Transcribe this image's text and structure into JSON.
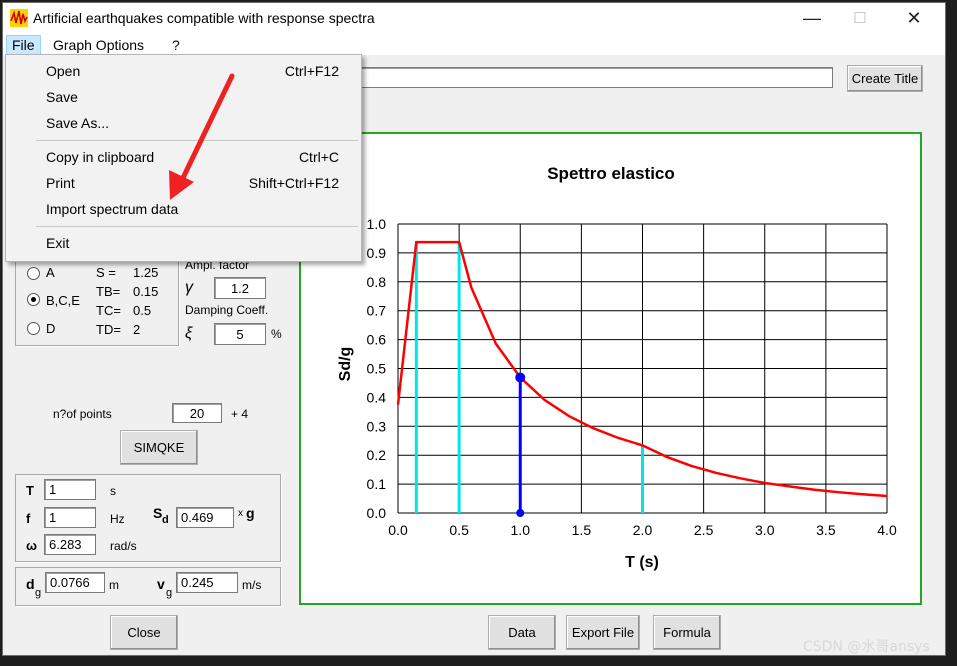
{
  "window": {
    "title": "Artificial earthquakes compatible with response spectra",
    "minimize": "—",
    "maximize": "☐",
    "close": "✕"
  },
  "menubar": {
    "file": "File",
    "graph_options": "Graph Options",
    "help": "?"
  },
  "file_menu": {
    "items": [
      {
        "label": "Open",
        "shortcut": "Ctrl+F12"
      },
      {
        "label": "Save",
        "shortcut": ""
      },
      {
        "label": "Save As...",
        "shortcut": ""
      },
      {
        "label": "Copy in clipboard",
        "shortcut": "Ctrl+C"
      },
      {
        "label": "Print",
        "shortcut": "Shift+Ctrl+F12"
      },
      {
        "label": "Import spectrum data",
        "shortcut": ""
      },
      {
        "label": "Exit",
        "shortcut": ""
      }
    ]
  },
  "title_input": {
    "value": ""
  },
  "create_title": "Create Title",
  "soil": {
    "options": [
      "A",
      "B,C,E",
      "D"
    ],
    "selected": "B,C,E",
    "params": [
      {
        "name": "S =",
        "value": "1.25"
      },
      {
        "name": "TB=",
        "value": "0.15"
      },
      {
        "name": "TC=",
        "value": "0.5"
      },
      {
        "name": "TD=",
        "value": "2"
      }
    ]
  },
  "ampl": {
    "label": "Ampl. factor",
    "symbol": "γ",
    "value": "1.2"
  },
  "damping": {
    "label": "Damping Coeff.",
    "symbol": "ξ",
    "value": "5",
    "unit": "%"
  },
  "points": {
    "label": "n?of points",
    "value": "20",
    "suffix": "+ 4"
  },
  "simqke": "SIMQKE",
  "period": {
    "T_label": "T",
    "T_value": "1",
    "T_unit": "s",
    "f_label": "f",
    "f_value": "1",
    "f_unit": "Hz",
    "w_label": "ω",
    "w_value": "6.283",
    "w_unit": "rad/s",
    "sd_label": "S",
    "sd_sub": "d",
    "sd_value": "0.469",
    "sd_unit_x": "x",
    "sd_unit_g": "g"
  },
  "disp": {
    "d_label": "d",
    "d_sub": "g",
    "d_value": "0.0766",
    "d_unit": "m",
    "v_label": "v",
    "v_sub": "g",
    "v_value": "0.245",
    "v_unit": "m/s"
  },
  "buttons": {
    "close": "Close",
    "data": "Data",
    "export": "Export File",
    "formula": "Formula"
  },
  "watermark": "CSDN @水哥ansys",
  "colors": {
    "spectrum": "#ff0000",
    "markers": "#00e5e5",
    "cursor": "#0000ff",
    "frame": "#22a822"
  },
  "chart_data": {
    "type": "line",
    "title": "Spettro elastico",
    "xlabel": "T (s)",
    "ylabel": "Sd/g",
    "xlim": [
      0,
      4
    ],
    "ylim": [
      0,
      1
    ],
    "grid": true,
    "x_ticks": [
      "0.0",
      "0.5",
      "1.0",
      "1.5",
      "2.0",
      "2.5",
      "3.0",
      "3.5",
      "4.0"
    ],
    "y_ticks": [
      "0.0",
      "0.1",
      "0.2",
      "0.3",
      "0.4",
      "0.5",
      "0.6",
      "0.7",
      "0.8",
      "0.9",
      "1.0"
    ],
    "series": [
      {
        "x": [
          0,
          0.15,
          0.5,
          0.6,
          0.8,
          1.0,
          1.2,
          1.4,
          1.6,
          1.8,
          2.0,
          2.2,
          2.4,
          2.6,
          2.8,
          3.0,
          3.2,
          3.4,
          3.6,
          3.8,
          4.0
        ],
        "y": [
          0.375,
          0.9375,
          0.9375,
          0.78,
          0.586,
          0.469,
          0.391,
          0.335,
          0.293,
          0.26,
          0.234,
          0.194,
          0.163,
          0.139,
          0.12,
          0.104,
          0.092,
          0.081,
          0.072,
          0.065,
          0.059
        ]
      }
    ],
    "markers_x": [
      0.15,
      0.5,
      2.0
    ],
    "cursor": {
      "x": 1.0,
      "y": 0.469
    }
  }
}
